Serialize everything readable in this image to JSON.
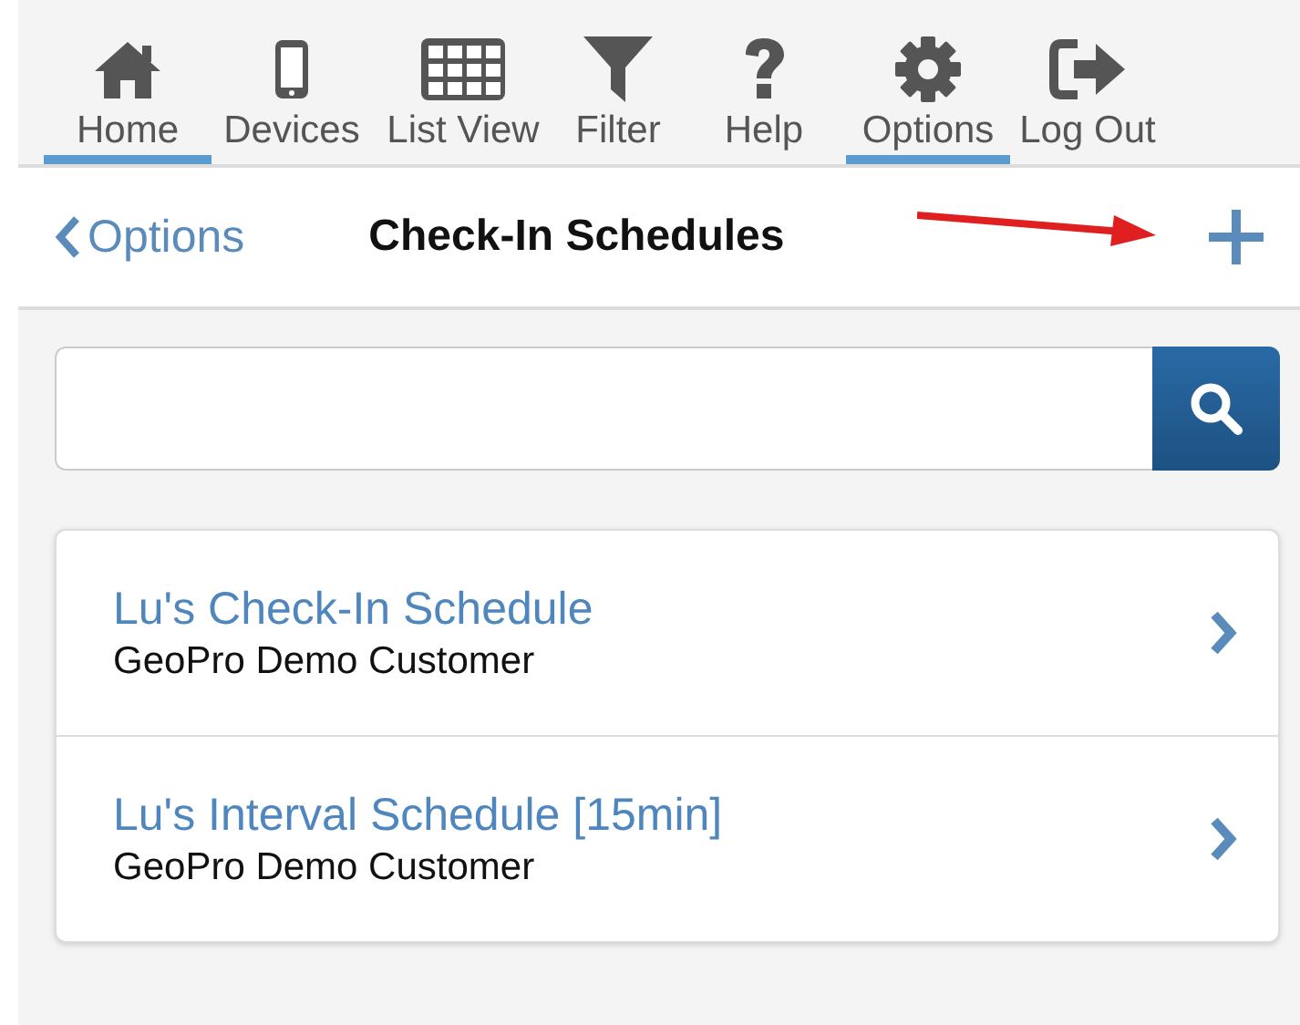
{
  "nav_tabs": [
    {
      "label": "Home",
      "selected": true
    },
    {
      "label": "Devices",
      "selected": false
    },
    {
      "label": "List View",
      "selected": false
    },
    {
      "label": "Filter",
      "selected": false
    },
    {
      "label": "Help",
      "selected": false
    },
    {
      "label": "Options",
      "selected": true
    },
    {
      "label": "Log Out",
      "selected": false
    }
  ],
  "header": {
    "back_label": "Options",
    "title": "Check-In Schedules"
  },
  "schedules": [
    {
      "name": "Lu's Check-In Schedule",
      "customer": "GeoPro Demo Customer"
    },
    {
      "name": "Lu's Interval Schedule [15min]",
      "customer": "GeoPro Demo Customer"
    }
  ]
}
